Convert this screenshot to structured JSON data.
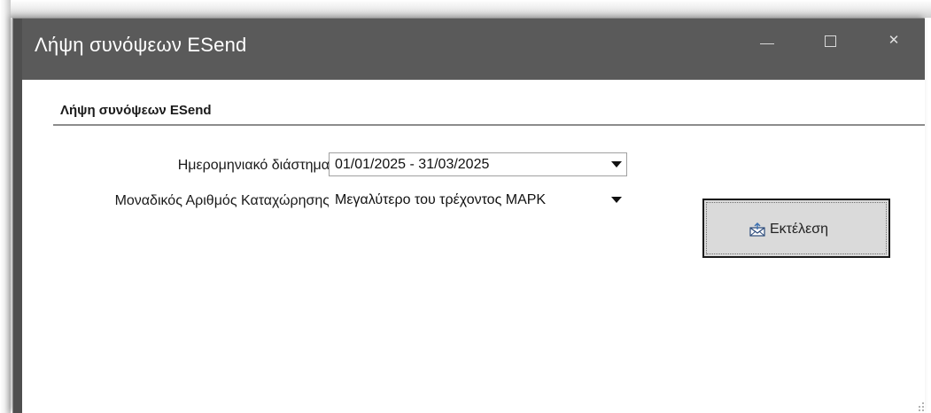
{
  "window": {
    "title": "Λήψη συνόψεων ESend",
    "controls": {
      "minimize_icon": "minimize-icon",
      "maximize_icon": "maximize-icon",
      "close_glyph": "✕"
    },
    "colors": {
      "titlebar": "#5a5a5a",
      "title_text": "#ffffff"
    }
  },
  "form": {
    "group_title": "Λήψη συνόψεων ESend",
    "date_range": {
      "label": "Ημερομηνιακό διάστημα",
      "value": "01/01/2025 - 31/03/2025"
    },
    "mark": {
      "label": "Μοναδικός Αριθμός Καταχώρησης",
      "value": "Μεγαλύτερο του τρέχοντος MAPK"
    },
    "run_button": {
      "label": "Εκτέλεση",
      "icon": "envelope-icon"
    }
  }
}
